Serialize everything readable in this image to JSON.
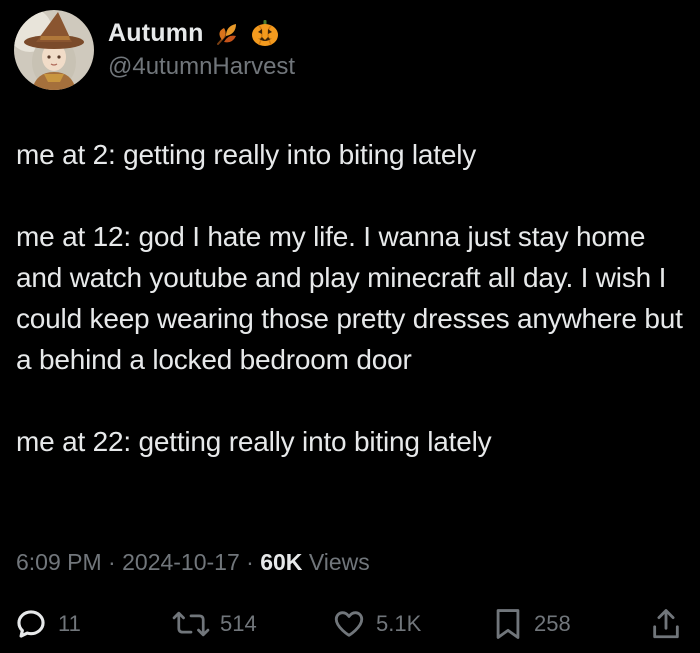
{
  "author": {
    "display_name": "Autumn",
    "handle": "@4utumnHarvest",
    "avatar": "avatar-witch-hat-character",
    "emojis": [
      "fallen-leaf-emoji",
      "jack-o-lantern-emoji"
    ]
  },
  "tweet": {
    "lines": [
      "me at 2: getting really into biting lately",
      "me at 12: god I hate my life. I wanna just stay home and watch youtube and play minecraft all day. I wish I could keep wearing those pretty dresses anywhere but a behind a locked bedroom door",
      "me at 22: getting really into biting lately"
    ]
  },
  "meta": {
    "time": "6:09 PM",
    "separator": "·",
    "date": "2024-10-17",
    "views_count": "60K",
    "views_label": "Views"
  },
  "actions": {
    "replies": "11",
    "reposts": "514",
    "likes": "5.1K",
    "bookmarks": "258"
  },
  "colors": {
    "background": "#000000",
    "primary_text": "#e7e9ea",
    "secondary_text": "#71767b"
  }
}
